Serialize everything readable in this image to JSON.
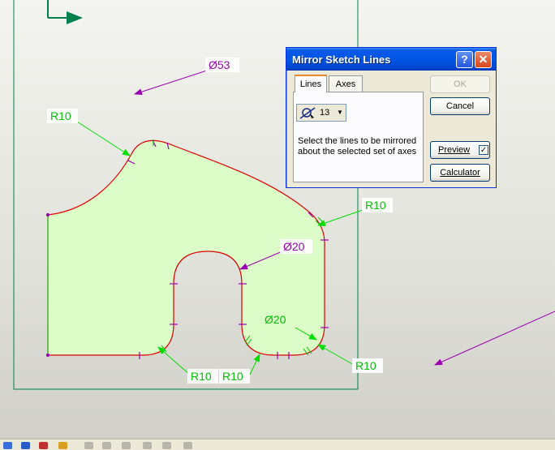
{
  "dialog": {
    "title": "Mirror Sketch Lines",
    "tabs": [
      {
        "label": "Lines"
      },
      {
        "label": "Axes"
      }
    ],
    "selection_count": "13",
    "instruction": "Select the lines to be mirrored about the selected set of axes",
    "buttons": {
      "ok": "OK",
      "cancel": "Cancel",
      "preview": "Preview",
      "calculator": "Calculator"
    },
    "preview_checked": "✓"
  },
  "dimensions": {
    "dia53": "Ø53",
    "r10_top": "R10",
    "r10_right": "R10",
    "dia20_slot": "Ø20",
    "dia20_bottom": "Ø20",
    "r10_bottom_left": "R10",
    "r10_bottom_mid": "R10",
    "r10_bottom_right": "R10"
  },
  "colors": {
    "profile": "#e00000",
    "fill": "#dcfcc8",
    "leader_green": "#00dd00",
    "leader_purple": "#9a00b0",
    "frame": "#00804a"
  }
}
